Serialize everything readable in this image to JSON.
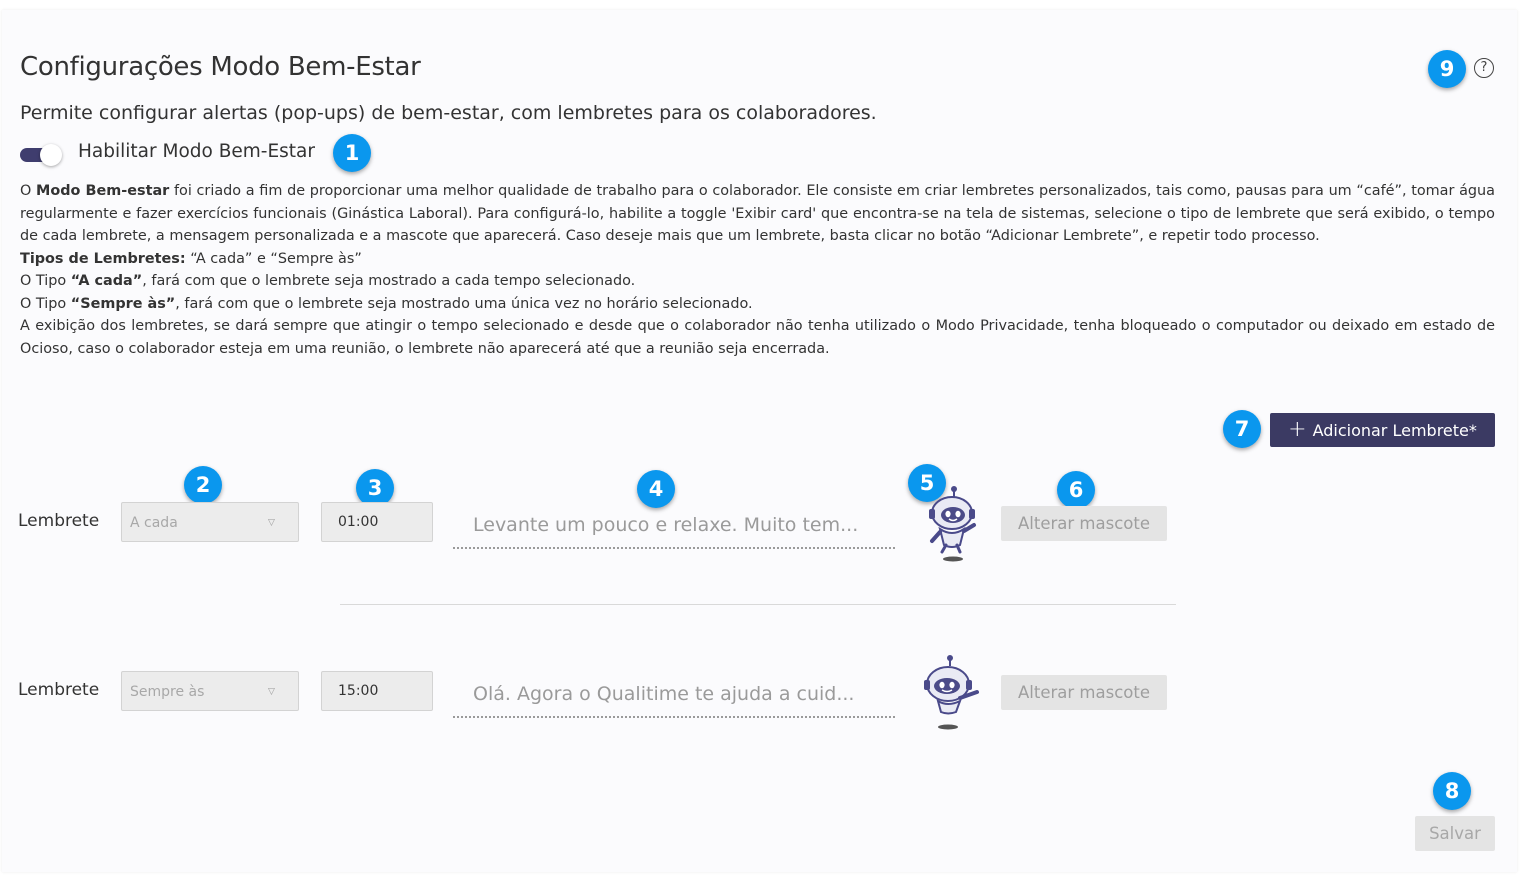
{
  "header": {
    "title": "Configurações Modo Bem-Estar",
    "subtitle": "Permite configurar alertas (pop-ups) de bem-estar, com lembretes para os colaboradores.",
    "help_icon": "?"
  },
  "toggle": {
    "label": "Habilitar Modo Bem-Estar",
    "enabled": true,
    "color": "#3f3d6e"
  },
  "description": {
    "p1_pre": "O ",
    "p1_bold": "Modo Bem-estar",
    "p1_rest": " foi criado a fim de proporcionar uma melhor qualidade de trabalho para o colaborador. Ele consiste em criar lembretes personalizados, tais como, pausas para um “café”, tomar água regularmente e fazer exercícios funcionais (Ginástica Laboral). Para configurá-lo, habilite a toggle 'Exibir card' que encontra-se na tela de sistemas, selecione o tipo de lembrete que será exibido, o tempo de cada lembrete, a mensagem personalizada e a mascote que aparecerá. Caso deseje mais que um lembrete, basta clicar no botão “Adicionar Lembrete”, e repetir todo processo.",
    "types_bold": "Tipos de Lembretes:",
    "types_rest": " “A cada” e “Sempre às”",
    "type1_pre": "O Tipo ",
    "type1_bold": "“A cada”",
    "type1_rest": ", fará com que o lembrete seja mostrado a cada tempo selecionado.",
    "type2_pre": "O Tipo ",
    "type2_bold": "“Sempre às”",
    "type2_rest": ", fará com que o lembrete seja mostrado uma única vez no horário selecionado.",
    "p_last": "A exibição dos lembretes, se dará sempre que atingir o tempo selecionado e desde que o colaborador não tenha utilizado o Modo Privacidade, tenha bloqueado o computador ou deixado em estado de Ocioso, caso o colaborador esteja em uma reunião, o lembrete não aparecerá até que a reunião seja encerrada."
  },
  "add_button": {
    "label": "Adicionar Lembrete*",
    "icon": "plus-icon",
    "color": "#3b3a63"
  },
  "reminders": [
    {
      "label": "Lembrete",
      "type": "A cada",
      "time": "01:00",
      "message": "Levante um pouco e relaxe. Muito tem...",
      "mascot": "robot-mascot-waving",
      "mascot_button": "Alterar mascote"
    },
    {
      "label": "Lembrete",
      "type": "Sempre às",
      "time": "15:00",
      "message": "Olá. Agora o Qualitime te ajuda a cuid...",
      "mascot": "robot-mascot-floating",
      "mascot_button": "Alterar mascote"
    }
  ],
  "save_button": {
    "label": "Salvar"
  },
  "badges": [
    "1",
    "2",
    "3",
    "4",
    "5",
    "6",
    "7",
    "8",
    "9"
  ],
  "badge_color": "#0a97ee"
}
